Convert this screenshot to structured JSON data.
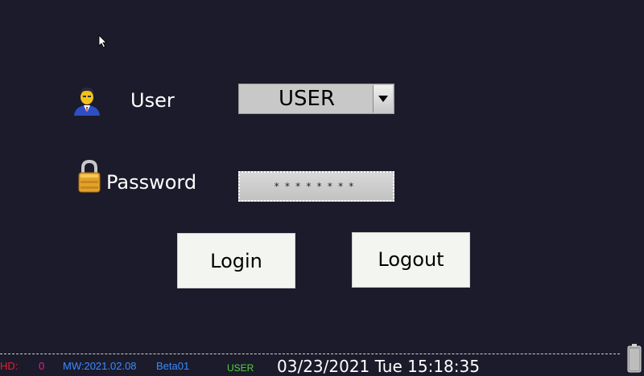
{
  "login": {
    "user_label": "User",
    "user_selected": "USER",
    "password_label": "Password",
    "password_masked": "********",
    "login_button": "Login",
    "logout_button": "Logout"
  },
  "status_bar": {
    "hd_label": "HD:",
    "hd_value": "0",
    "mw_version": "MW:2021.02.08",
    "build": "Beta01",
    "current_user": "USER",
    "datetime": "03/23/2021 Tue 15:18:35"
  },
  "colors": {
    "background": "#1b1b2b",
    "button": "#f3f6f0",
    "field": "#c8c8c8",
    "status_red": "#e0202a",
    "status_blue": "#3a8aff",
    "status_green": "#52d43a"
  },
  "icons": {
    "user": "user-avatar-icon",
    "password": "padlock-icon",
    "dropdown": "chevron-down-icon",
    "battery": "battery-icon"
  }
}
